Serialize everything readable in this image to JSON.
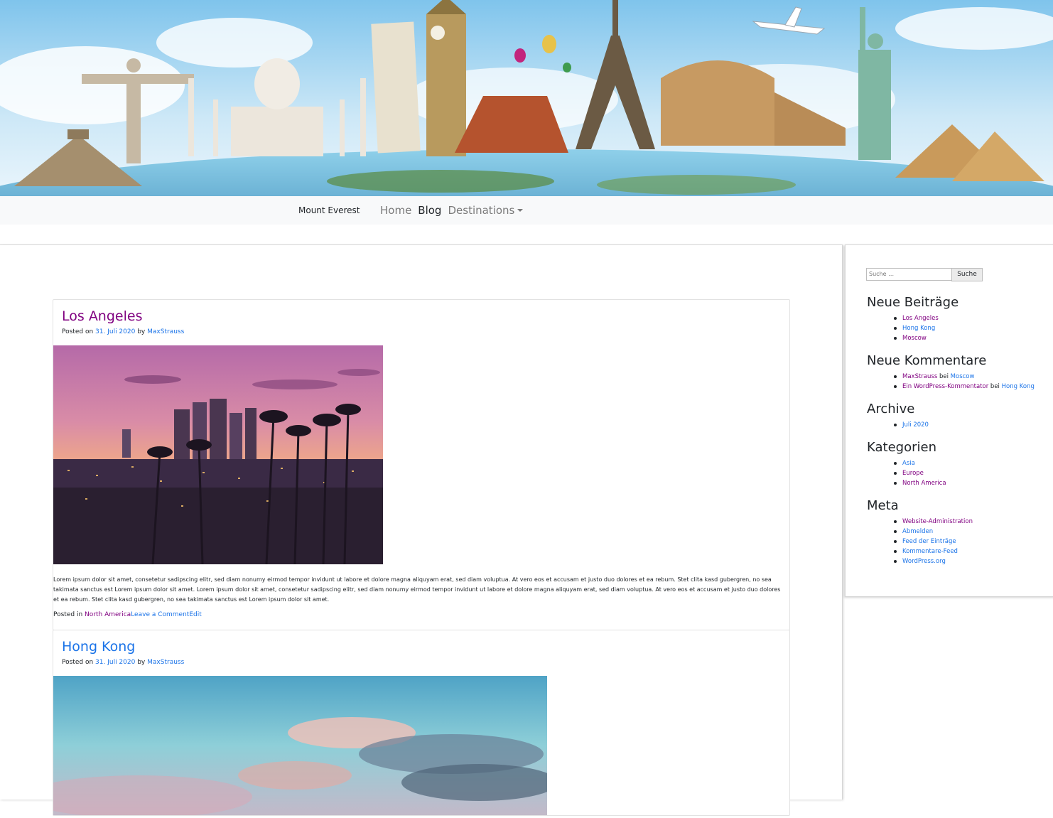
{
  "header": {
    "banner_alt": "World landmarks banner"
  },
  "navbar": {
    "brand": "Mount Everest",
    "links": [
      {
        "label": "Home"
      },
      {
        "label": "Blog"
      },
      {
        "label": "Destinations"
      }
    ]
  },
  "posts": [
    {
      "title": "Los Angeles",
      "meta_prefix": "Posted on",
      "date": "31. Juli 2020",
      "by": "by",
      "author": "MaxStrauss",
      "excerpt": "Lorem ipsum dolor sit amet, consetetur sadipscing elitr, sed diam nonumy eirmod tempor invidunt ut labore et dolore magna aliquyam erat, sed diam voluptua. At vero eos et accusam et justo duo dolores et ea rebum. Stet clita kasd gubergren, no sea takimata sanctus est Lorem ipsum dolor sit amet. Lorem ipsum dolor sit amet, consetetur sadipscing elitr, sed diam nonumy eirmod tempor invidunt ut labore et dolore magna aliquyam erat, sed diam voluptua. At vero eos et accusam et justo duo dolores et ea rebum. Stet clita kasd gubergren, no sea takimata sanctus est Lorem ipsum dolor sit amet.",
      "footer_prefix": "Posted in",
      "category": "North America",
      "comment_link": "Leave a Comment",
      "edit_link": "Edit"
    },
    {
      "title": "Hong Kong",
      "meta_prefix": "Posted on",
      "date": "31. Juli 2020",
      "by": "by",
      "author": "MaxStrauss"
    }
  ],
  "sidebar": {
    "search_placeholder": "Suche …",
    "search_button": "Suche",
    "recent_posts": {
      "title": "Neue Beiträge",
      "items": [
        "Los Angeles",
        "Hong Kong",
        "Moscow"
      ]
    },
    "recent_comments": {
      "title": "Neue Kommentare",
      "items": [
        {
          "author": "MaxStrauss",
          "sep": "bei",
          "post": "Moscow"
        },
        {
          "author": "Ein WordPress-Kommentator",
          "sep": "bei",
          "post": "Hong Kong"
        }
      ]
    },
    "archive": {
      "title": "Archive",
      "items": [
        "Juli 2020"
      ]
    },
    "categories": {
      "title": "Kategorien",
      "items": [
        "Asia",
        "Europe",
        "North America"
      ]
    },
    "meta": {
      "title": "Meta",
      "items": [
        "Website-Administration",
        "Abmelden",
        "Feed der Einträge",
        "Kommentare-Feed",
        "WordPress.org"
      ]
    }
  },
  "colors": {
    "link_visited": "#800080",
    "link": "#1a73e8",
    "navbar_bg": "#f8f9fa",
    "text": "#212529"
  }
}
